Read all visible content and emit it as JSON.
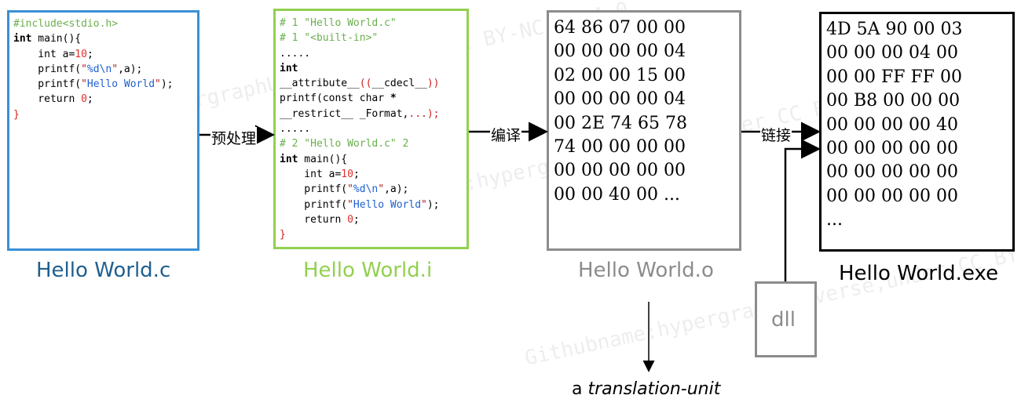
{
  "colors": {
    "c": "#3b8fd4",
    "i": "#92d050",
    "o": "#8c8c8c",
    "exe": "#000000",
    "dll": "#8c8c8c"
  },
  "c_box": {
    "lines": [
      [
        [
          "cm",
          "#include<stdio.h>"
        ]
      ],
      [
        [
          "kw",
          "int"
        ],
        [
          "",
          " main(){"
        ]
      ],
      [
        [
          "",
          "    int a="
        ],
        [
          "num",
          "10"
        ],
        [
          "",
          ";"
        ]
      ],
      [
        [
          "",
          "    printf("
        ],
        [
          "str",
          "\""
        ],
        [
          "fmt",
          "%d\\n"
        ],
        [
          "str",
          "\""
        ],
        [
          "",
          ",a);"
        ]
      ],
      [
        [
          "",
          "    printf("
        ],
        [
          "str",
          "\""
        ],
        [
          "fmt",
          "Hello World"
        ],
        [
          "str",
          "\""
        ],
        [
          "",
          ");"
        ]
      ],
      [
        [
          "",
          "    return "
        ],
        [
          "num",
          "0"
        ],
        [
          "",
          ";"
        ]
      ],
      [
        [
          "red",
          "}"
        ]
      ]
    ]
  },
  "i_box": {
    "lines": [
      [
        [
          "cm",
          "# 1 \"Hello World.c\""
        ]
      ],
      [
        [
          "cm",
          "# 1 \"<built-in>\""
        ]
      ],
      [
        [
          "",
          "....."
        ]
      ],
      [
        [
          "kw",
          "int"
        ]
      ],
      [
        [
          "",
          "__attribute__"
        ],
        [
          "red",
          "(("
        ],
        [
          "",
          "__cdecl__"
        ],
        [
          "red",
          "))"
        ]
      ],
      [
        [
          "",
          "printf(const char "
        ],
        [
          "kw",
          "*"
        ]
      ],
      [
        [
          "",
          "__restrict__ _Format,"
        ],
        [
          "red",
          "...);"
        ]
      ],
      [
        [
          "",
          "....."
        ]
      ],
      [
        [
          "cm",
          "# 2 \"Hello World.c\" 2"
        ]
      ],
      [
        [
          "kw",
          "int"
        ],
        [
          "",
          " main(){"
        ]
      ],
      [
        [
          "",
          "    int a="
        ],
        [
          "num",
          "10"
        ],
        [
          "",
          ";"
        ]
      ],
      [
        [
          "",
          "    printf("
        ],
        [
          "str",
          "\""
        ],
        [
          "fmt",
          "%d\\n"
        ],
        [
          "str",
          "\""
        ],
        [
          "",
          ",a);"
        ]
      ],
      [
        [
          "",
          "    printf("
        ],
        [
          "str",
          "\""
        ],
        [
          "fmt",
          "Hello World"
        ],
        [
          "str",
          "\""
        ],
        [
          "",
          ");"
        ]
      ],
      [
        [
          "",
          "    return "
        ],
        [
          "num",
          "0"
        ],
        [
          "",
          ";"
        ]
      ],
      [
        [
          "red",
          "}"
        ]
      ]
    ]
  },
  "o_box": {
    "lines": [
      "64 86 07 00 00",
      "00 00 00 00 04",
      "02 00 00 15 00",
      "00 00 00 00 04",
      "00 2E 74 65 78",
      "74 00 00 00 00",
      "00 00 00 00 00",
      "00 00 40 00 ..."
    ]
  },
  "exe_box": {
    "lines": [
      "4D 5A 90 00 03",
      "00 00 00 04 00",
      "00 00 FF FF 00",
      "00 B8 00 00 00",
      "00 00 00 00 40",
      "00 00 00 00 00",
      "00 00 00 00 00",
      "00 00 00 00 00",
      "..."
    ]
  },
  "captions": {
    "c": "Hello World.c",
    "i": "Hello World.i",
    "o": "Hello World.o",
    "exe": "Hello World.exe"
  },
  "steps": {
    "preprocess": "预处理",
    "compile": "编译",
    "link": "链接"
  },
  "dll_label": "dll",
  "tu_prefix": "a ",
  "tu_term": "translation-unit",
  "watermark": [
    "Githubname:hypergraphUniverse,under CC BY-NC-SA 4.0",
    "Githubname:hypergraphUniverse,under CC BY-NC-SA 4.0",
    "Githubname:hypergraphUniverse,under CC BY-NC-SA 4.0"
  ]
}
